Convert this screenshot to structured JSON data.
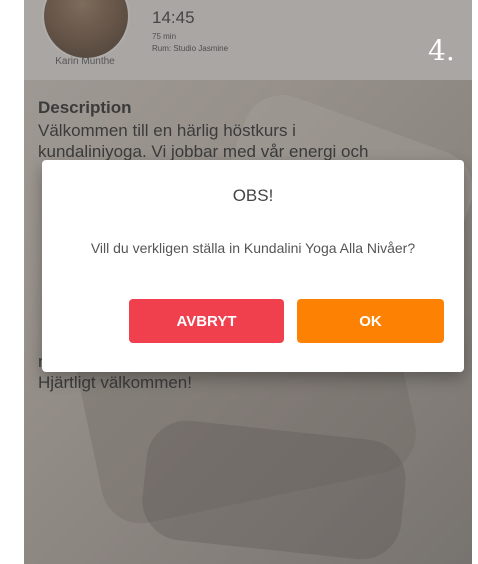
{
  "class_info": {
    "coach_name": "Karin Munthe",
    "time": "14:45",
    "duration": "75 min",
    "room": "Rum: Studio Jasmine"
  },
  "description": {
    "heading": "Description",
    "text": "Välkommen till en härlig höstkurs i\nkundaliniyoga. Vi jobbar med vår energi och\n\n\n\n\n\n\n\n\n\nnybörjare som erfarna yogis.\nHjärtligt välkommen!"
  },
  "dialog": {
    "title": "OBS!",
    "message": "Vill du verkligen ställa in Kundalini Yoga Alla Nivåer?",
    "cancel_label": "AVBRYT",
    "ok_label": "OK"
  },
  "step_label": "4.",
  "colors": {
    "cancel": "#f0404d",
    "ok": "#fd8203"
  }
}
